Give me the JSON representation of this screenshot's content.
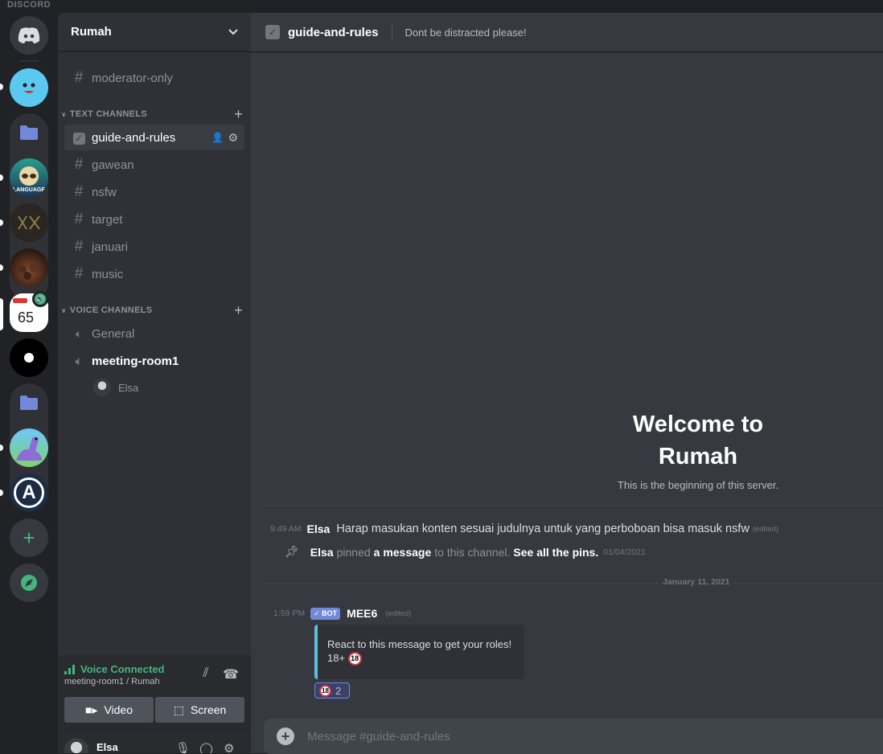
{
  "app": {
    "wordmark": "DISCORD"
  },
  "colors": {
    "accent": "#7289da",
    "online": "#43b581",
    "background": "#36393f",
    "sidebar": "#2f3136",
    "rail": "#202225"
  },
  "servers": [
    {
      "name": "home",
      "icon": "discord-logo-icon"
    },
    {
      "name": "smiley-server",
      "icon": "smiley-face-icon"
    },
    {
      "name": "folder-1",
      "icon": "folder-icon"
    },
    {
      "name": "language-server",
      "icon": "sloth-icon",
      "label": "LANGUAGE"
    },
    {
      "name": "xx-server",
      "icon": "xx-logo-icon"
    },
    {
      "name": "crowd-server",
      "icon": "crowd-image-icon"
    },
    {
      "name": "speed-server",
      "icon": "speed-icon",
      "label": "65"
    },
    {
      "name": "dot-server",
      "icon": "black-dot-icon"
    },
    {
      "name": "folder-2",
      "icon": "folder-icon"
    },
    {
      "name": "dino-server",
      "icon": "dinosaur-icon"
    },
    {
      "name": "a-server",
      "icon": "letter-a-icon",
      "label": "A"
    }
  ],
  "guild": {
    "name": "Rumah"
  },
  "channels": {
    "top": {
      "name": "moderator-only"
    },
    "text_category": "TEXT CHANNELS",
    "text": [
      {
        "name": "guide-and-rules"
      },
      {
        "name": "gawean"
      },
      {
        "name": "nsfw"
      },
      {
        "name": "target"
      },
      {
        "name": "januari"
      },
      {
        "name": "music"
      }
    ],
    "voice_category": "VOICE CHANNELS",
    "voice": [
      {
        "name": "General"
      },
      {
        "name": "meeting-room1"
      }
    ],
    "voice_users": [
      {
        "name": "Elsa"
      }
    ]
  },
  "voice_panel": {
    "status": "Voice Connected",
    "location": "meeting-room1 / Rumah",
    "video_label": "Video",
    "screen_label": "Screen"
  },
  "user_panel": {
    "name": "Elsa"
  },
  "header": {
    "channel": "guide-and-rules",
    "topic": "Dont be distracted please!"
  },
  "welcome": {
    "title_line1": "Welcome to",
    "title_line2": "Rumah",
    "subtitle": "This is the beginning of this server."
  },
  "messages": [
    {
      "time": "9:49 AM",
      "author": "Elsa",
      "text": "Harap masukan konten sesuai judulnya untuk yang perboboan bisa masuk nsfw",
      "edited": "(edited)"
    },
    {
      "author": "Elsa",
      "pinned_text": "pinned",
      "link": "a message",
      "rest": "to this channel.",
      "see_pins": "See all the pins.",
      "date": "01/04/2021"
    }
  ],
  "date_divider": "January 11, 2021",
  "bot_message": {
    "time": "1:59 PM",
    "bot_tag": "✓ BOT",
    "author": "MEE6",
    "edited": "(edited)",
    "embed_line1": "React to this message to get your roles!",
    "embed_line2": "18+",
    "reaction_emoji": "18",
    "reaction_count": "2"
  },
  "composer": {
    "placeholder": "Message #guide-and-rules"
  }
}
